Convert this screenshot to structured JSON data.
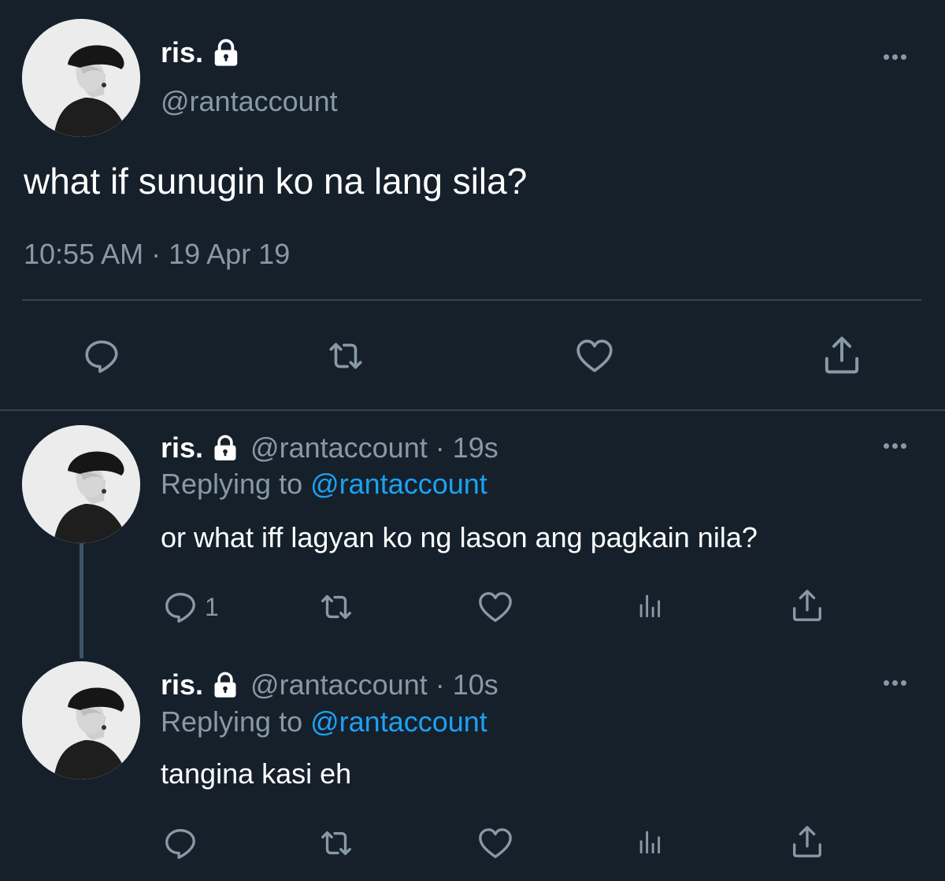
{
  "main_tweet": {
    "display_name": "ris.",
    "handle": "@rantaccount",
    "text": "what if sunugin ko na lang sila?",
    "timestamp": "10:55 AM · 19 Apr 19",
    "actions": [
      "reply-icon",
      "retweet-icon",
      "like-icon",
      "share-icon"
    ]
  },
  "replies": [
    {
      "display_name": "ris.",
      "handle_time": "@rantaccount · 19s",
      "replying_prefix": "Replying to",
      "replying_to": "@rantaccount",
      "text": "or what iff lagyan ko ng lason ang pagkain nila?",
      "reply_count": "1",
      "actions": [
        "reply-icon",
        "retweet-icon",
        "like-icon",
        "analytics-icon",
        "share-icon"
      ]
    },
    {
      "display_name": "ris.",
      "handle_time": "@rantaccount · 10s",
      "replying_prefix": "Replying to",
      "replying_to": "@rantaccount",
      "text": "tangina kasi eh",
      "reply_count": "",
      "actions": [
        "reply-icon",
        "retweet-icon",
        "like-icon",
        "analytics-icon",
        "share-icon"
      ]
    }
  ],
  "colors": {
    "background": "#15202b",
    "primary_text": "#ffffff",
    "secondary_text": "#8899a6",
    "link": "#1da1f2",
    "divider": "#38444d"
  }
}
